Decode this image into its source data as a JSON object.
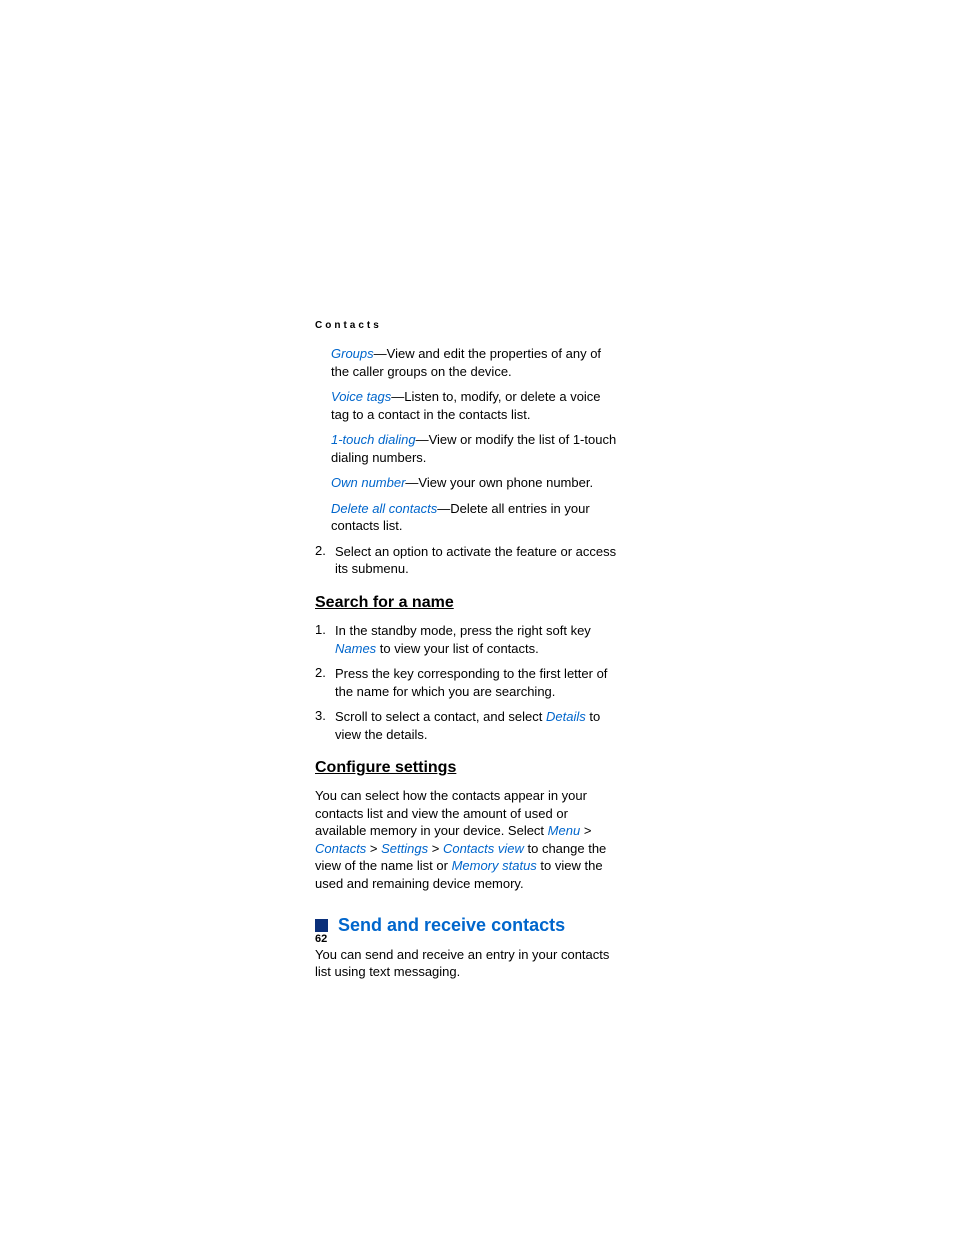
{
  "header": "Contacts",
  "items": [
    {
      "term": "Groups",
      "desc": "—View and edit the properties of any of the caller groups on the device."
    },
    {
      "term": "Voice tags",
      "desc": "—Listen to, modify, or delete a voice tag to a contact in the contacts list."
    },
    {
      "term": "1-touch dialing",
      "desc": "—View or modify the list of 1-touch dialing numbers."
    },
    {
      "term": "Own number",
      "desc": "—View your own phone number."
    },
    {
      "term": "Delete all contacts",
      "desc": "—Delete all entries in your contacts list."
    }
  ],
  "step2": {
    "num": "2.",
    "text": "Select an option to activate the feature or access its submenu."
  },
  "search": {
    "title": "Search for a name",
    "steps": [
      {
        "num": "1.",
        "pre": "In the standby mode, press the right soft key ",
        "link": "Names",
        "post": " to view your list of contacts."
      },
      {
        "num": "2.",
        "pre": "Press the key corresponding to the first letter of the name for which you are searching.",
        "link": "",
        "post": ""
      },
      {
        "num": "3.",
        "pre": "Scroll to select a contact, and select ",
        "link": "Details",
        "post": " to view the details."
      }
    ]
  },
  "configure": {
    "title": "Configure settings",
    "p1a": "You can select how the contacts appear in your contacts list and view the amount of used or available memory in your device. Select ",
    "menu": "Menu",
    "sep": " > ",
    "contacts": "Contacts",
    "settings": "Settings",
    "contacts_view": "Contacts view",
    "p1b": " to change the view of the name list or ",
    "memory": "Memory status",
    "p1c": " to view the used and remaining device memory."
  },
  "send": {
    "title": "Send and receive contacts",
    "p": "You can send and receive an entry in your contacts list using text messaging."
  },
  "page_num": "62"
}
